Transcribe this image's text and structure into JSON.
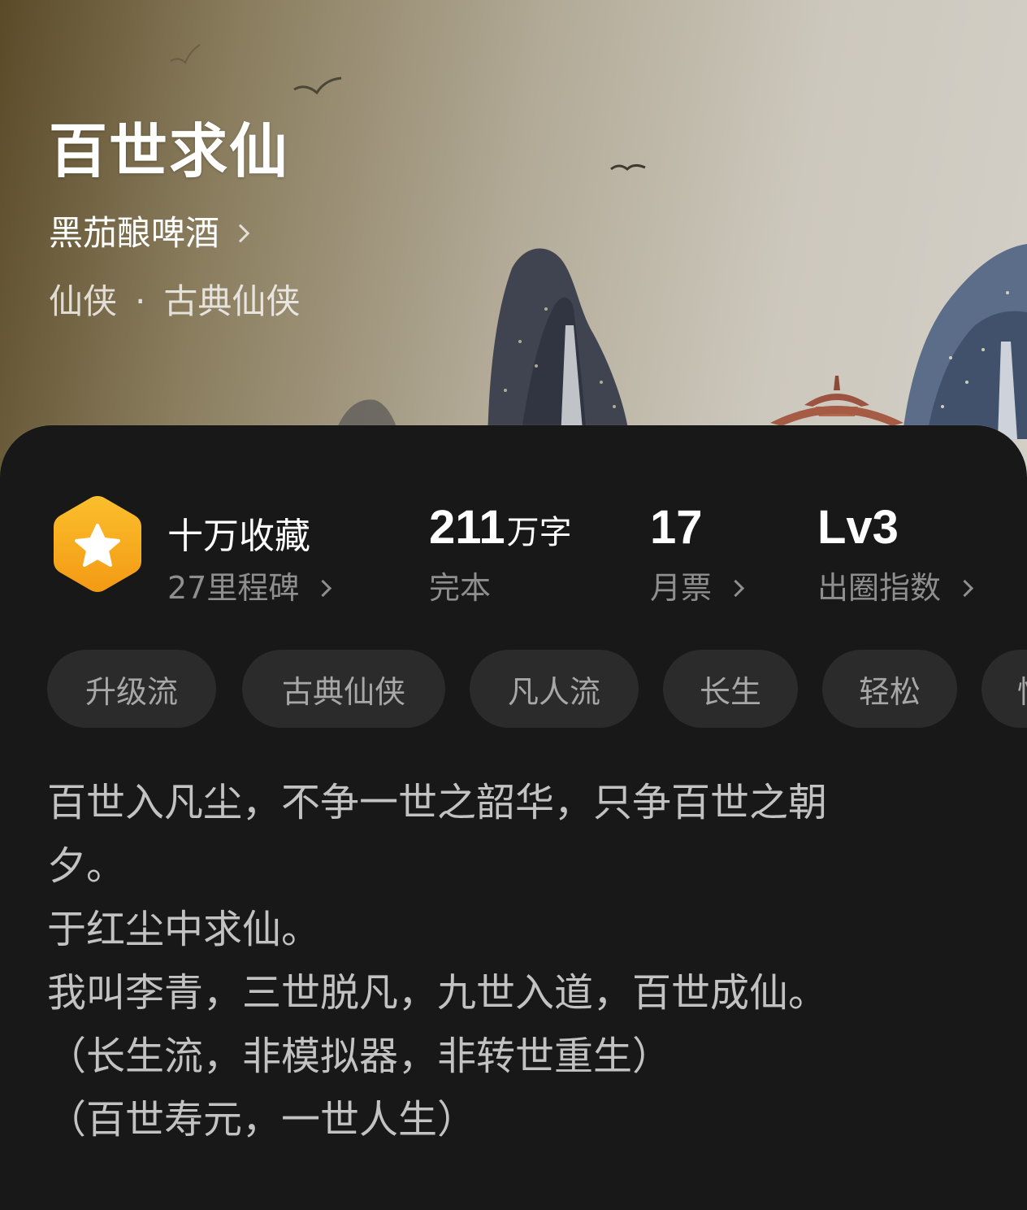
{
  "hero": {
    "title": "百世求仙",
    "author": "黑茄酿啤酒",
    "genre_main": "仙侠",
    "genre_separator": "·",
    "genre_sub": "古典仙侠"
  },
  "stats": {
    "collection": {
      "label": "十万收藏",
      "sub": "27里程碑"
    },
    "words": {
      "value": "211",
      "unit": "万字",
      "sub": "完本"
    },
    "monthly_ticket": {
      "value": "17",
      "sub": "月票"
    },
    "popularity": {
      "value": "Lv3",
      "sub": "出圈指数"
    }
  },
  "tags": [
    "升级流",
    "古典仙侠",
    "凡人流",
    "长生",
    "轻松",
    "悟"
  ],
  "synopsis": {
    "lines": [
      "百世入凡尘，不争一世之韶华，只争百世之朝",
      "夕。",
      "于红尘中求仙。",
      "我叫李青，三世脱凡，九世入道，百世成仙。",
      "（长生流，非模拟器，非转世重生）",
      "（百世寿元，一世人生）"
    ]
  },
  "colors": {
    "card_bg": "#181818",
    "tag_bg": "#2b2b2b",
    "badge_gold": "#f5a623"
  },
  "icons": {
    "badge": "star-hexagon-icon",
    "chevron": "chevron-right-icon"
  }
}
